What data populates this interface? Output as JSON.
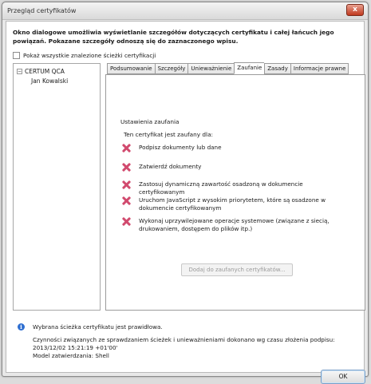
{
  "window": {
    "title": "Przegląd certyfikatów",
    "close_glyph": "x"
  },
  "intro": "Okno dialogowe umożliwia wyświetlanie szczegółów dotyczących certyfikatu i całej łańcuch jego powiązań. Pokazane szczegóły odnoszą się do zaznaczonego wpisu.",
  "show_all_paths_label": "Pokaż wszystkie znalezione ścieżki certyfikacji",
  "tree": {
    "toggle_glyph": "−",
    "root": "CERTUM QCA",
    "child": "Jan Kowalski"
  },
  "tabs": [
    {
      "label": "Podsumowanie"
    },
    {
      "label": "Szczegóły"
    },
    {
      "label": "Unieważnienie"
    },
    {
      "label": "Zaufanie"
    },
    {
      "label": "Zasady"
    },
    {
      "label": "Informacje prawne"
    }
  ],
  "active_tab": "Zaufanie",
  "trust": {
    "heading": "Ustawienia zaufania",
    "subheading": "Ten certyfikat jest zaufany dla:",
    "purposes": [
      {
        "text": "Podpisz dokumenty lub dane",
        "icon": "red-x-icon"
      },
      {
        "text": "Zatwierdź dokumenty",
        "icon": "red-x-icon"
      },
      {
        "text": "Zastosuj dynamiczną zawartość osadzoną w dokumencie certyfikowanym",
        "icon": "red-x-icon"
      },
      {
        "text": "Uruchom JavaScript z wysokim priorytetem, które są osadzone w dokumencie certyfikowanym",
        "icon": "red-x-icon"
      },
      {
        "text": "Wykonaj uprzywilejowane operacje systemowe (związane z siecią, drukowaniem, dostępem do plików itp.)",
        "icon": "red-x-icon"
      }
    ],
    "add_button": "Dodaj do zaufanych certyfikatów..."
  },
  "status": {
    "icon_glyph": "i",
    "path_valid": "Wybrana ścieżka certyfikatu jest prawidłowa.",
    "verify_lines": [
      "Czynności związanych ze sprawdzaniem ścieżek i unieważnieniami dokonano wg czasu złożenia podpisu:",
      "2013/12/02 15:21:19 +01'00'",
      "Model zatwierdzania: Shell"
    ]
  },
  "ok_label": "OK",
  "colors": {
    "x_icon": "#d14a6e",
    "info_icon": "#2f6fd1",
    "close": "#c0391f"
  }
}
